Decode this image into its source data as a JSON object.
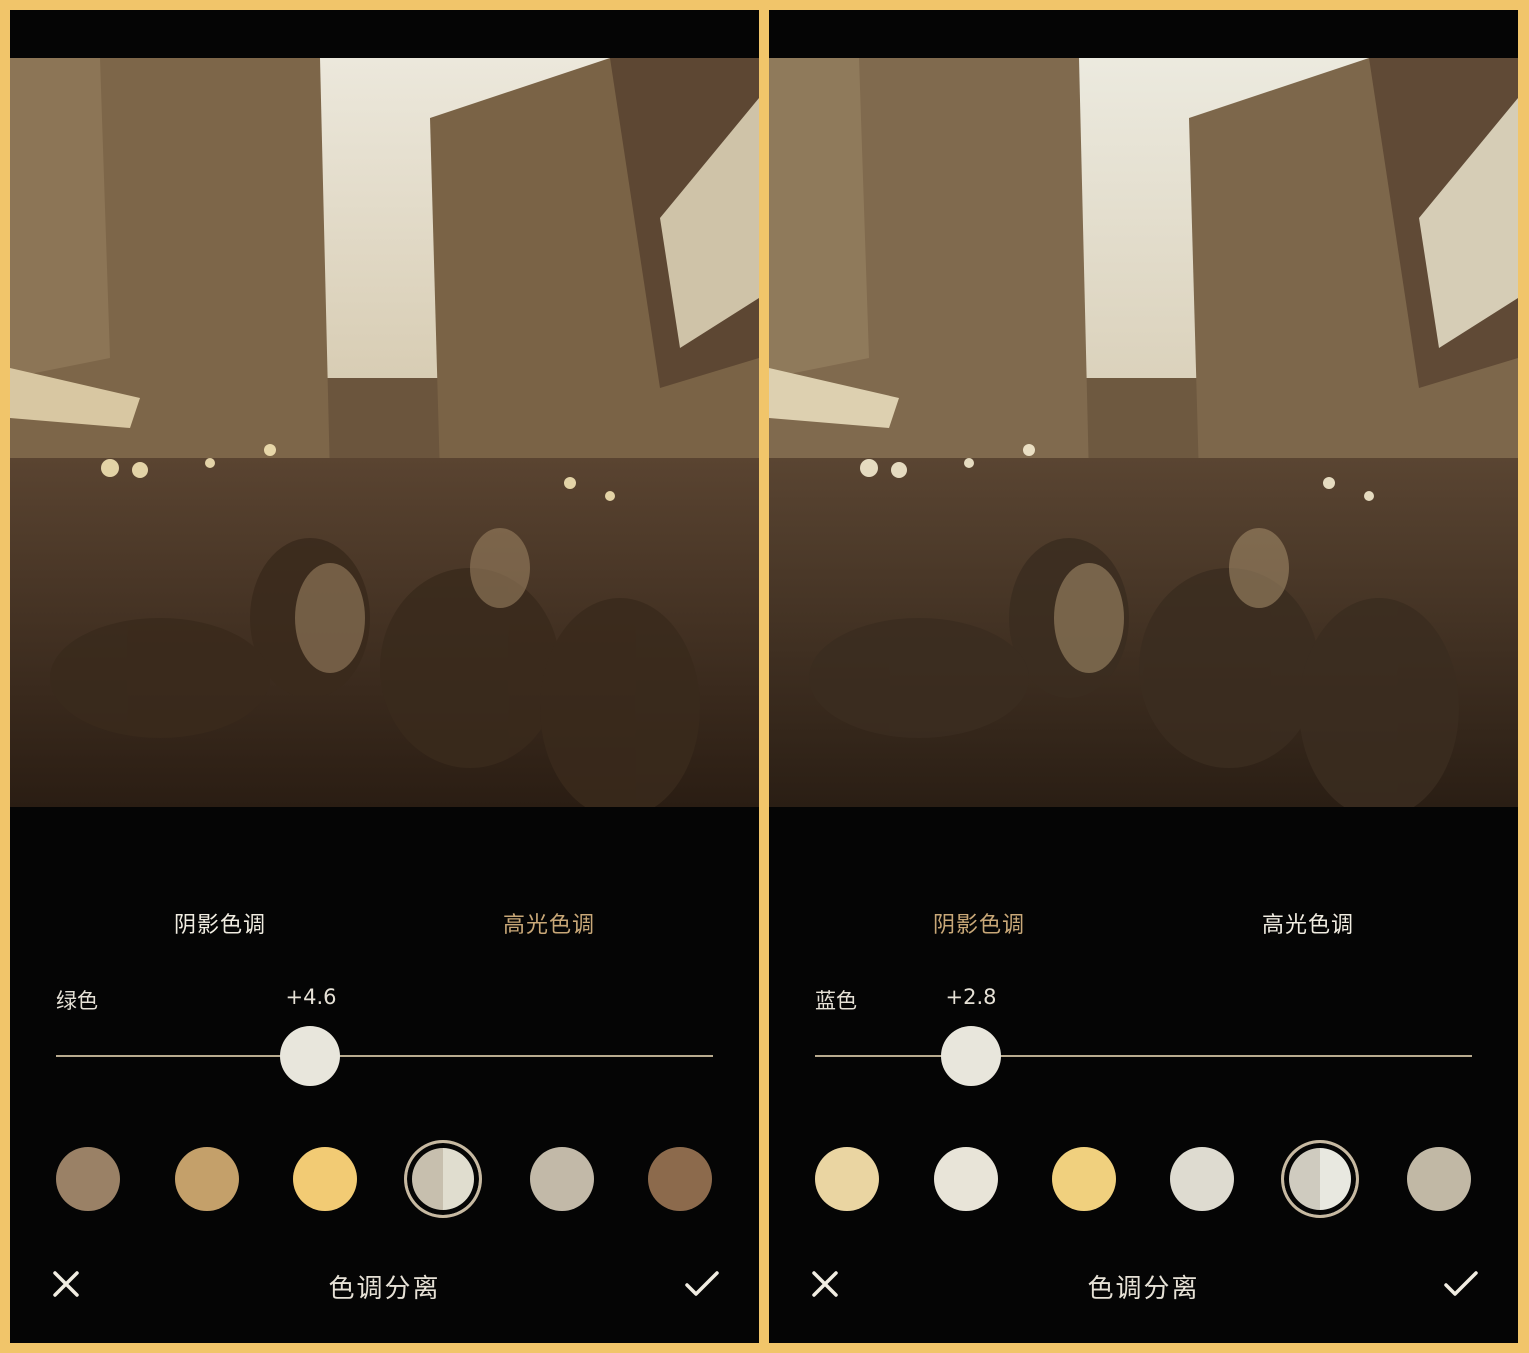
{
  "colors": {
    "tab_active": "#f1ede2",
    "tab_inactive": "#c9a878",
    "accent_frame": "#f1c56a"
  },
  "left": {
    "tabs": [
      {
        "label": "阴影色调",
        "active": true
      },
      {
        "label": "高光色调",
        "active": false
      }
    ],
    "slider": {
      "label": "绿色",
      "value_text": "+4.6",
      "fraction": 0.387
    },
    "swatches": [
      {
        "name": "swatch-taupe",
        "color": "#9a8166",
        "selected": false
      },
      {
        "name": "swatch-tan",
        "color": "#c4a06a",
        "selected": false
      },
      {
        "name": "swatch-yellow",
        "color": "#f2cb74",
        "selected": false
      },
      {
        "name": "swatch-split",
        "color": "#c7bfae",
        "color2": "#e0ddcf",
        "selected": true
      },
      {
        "name": "swatch-grey",
        "color": "#c2b9a8",
        "selected": false
      },
      {
        "name": "swatch-brown",
        "color": "#8c6a4c",
        "selected": false
      }
    ],
    "title": "色调分离",
    "cancel_icon": "close-icon",
    "confirm_icon": "check-icon"
  },
  "right": {
    "tabs": [
      {
        "label": "阴影色调",
        "active": false
      },
      {
        "label": "高光色调",
        "active": true
      }
    ],
    "slider": {
      "label": "蓝色",
      "value_text": "+2.8",
      "fraction": 0.238
    },
    "swatches": [
      {
        "name": "swatch-cream",
        "color": "#ead5a2",
        "selected": false
      },
      {
        "name": "swatch-ivory",
        "color": "#e8e4d8",
        "selected": false
      },
      {
        "name": "swatch-yellow",
        "color": "#f0d07e",
        "selected": false
      },
      {
        "name": "swatch-offwhite",
        "color": "#dedbd0",
        "selected": false
      },
      {
        "name": "swatch-split",
        "color": "#cfcbbf",
        "color2": "#e8e8e0",
        "selected": true
      },
      {
        "name": "swatch-stone",
        "color": "#c1b8a5",
        "selected": false
      }
    ],
    "title": "色调分离",
    "cancel_icon": "close-icon",
    "confirm_icon": "check-icon"
  }
}
